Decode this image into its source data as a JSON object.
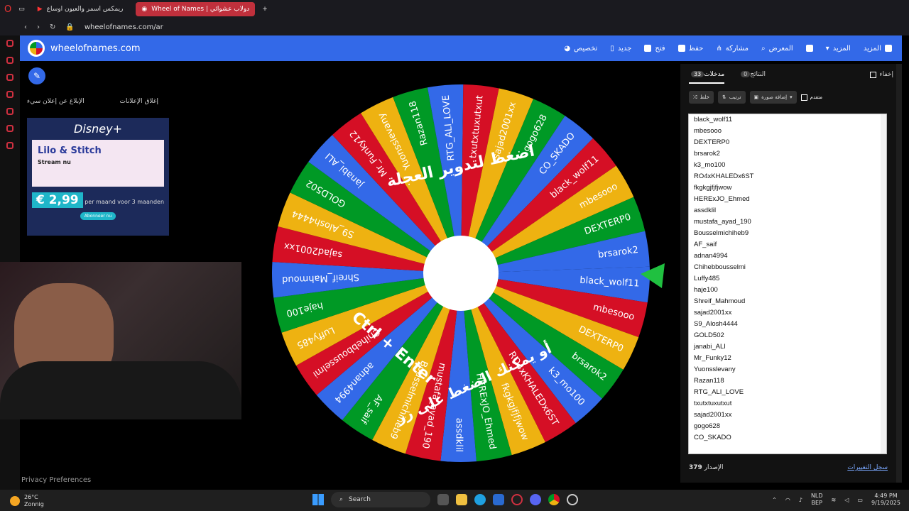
{
  "browser": {
    "tabs": [
      {
        "label": "ريمكس اسمر والعيون اوساع"
      },
      {
        "label": "Wheel of Names | دولاب عشوائي"
      }
    ],
    "url": "wheelofnames.com/ar"
  },
  "header": {
    "site_name": "wheelofnames.com",
    "menu": [
      "المزيد",
      "المزيد",
      "المعرض",
      "مشاركة",
      "حفظ",
      "فتح",
      "جديد",
      "تخصيص"
    ]
  },
  "ad": {
    "report_label": "الإبلاغ عن إعلان سيء",
    "close_label": "إغلاق الإعلانات",
    "brand": "Disney+",
    "movie": "Lilo & Stitch",
    "stream": "Stream nu",
    "price": "€ 2,99",
    "price_note": "per maand voor 3 maanden",
    "cta": "Abonneer nu"
  },
  "wheel": {
    "center_color": "#ffffff",
    "colors": [
      "#3369e8",
      "#d50f25",
      "#eeb211",
      "#009925"
    ],
    "overlay_text_1": "اضغط لتدوير العجلة",
    "overlay_text_2": "أو يمكنك الضغط على زر",
    "overlay_text_3": "Ctrl + Enter",
    "pointer_color": "#20c040"
  },
  "panel": {
    "tab_entries": "مدخلات",
    "entries_count": "33",
    "tab_results": "النتائج",
    "results_count": "0",
    "hide_label": "إخفاء",
    "shuffle_label": "خلط",
    "sort_label": "ترتيب",
    "add_image_label": "إضافة صورة",
    "advanced_label": "متقدم",
    "entries": [
      "black_wolf11",
      "mbesooo",
      "DEXTERP0",
      "brsarok2",
      "k3_mo100",
      "RO4xKHALEDx6ST",
      "fkgkgjfjfjwow",
      "HERExJO_Ehmed",
      "assdklil",
      "mustafa_ayad_190",
      "Bousselmichiheb9",
      "AF_saif",
      "adnan4994",
      "Chihebbousselmi",
      "Luffy485",
      "haje100",
      "Shreif_Mahmoud",
      "sajad2001xx",
      "S9_Alosh4444",
      "GOLD502",
      "janabi_ALI",
      "Mr_Funky12",
      "Yuonsslevany",
      "Razan118",
      "RTG_ALI_LOVE",
      "txutxtuxutxut",
      "sajad2001xx",
      "gogo628",
      "CO_SKADO"
    ],
    "version_label": "الإصدار",
    "version": "379",
    "changelog": "سجل التغييرات"
  },
  "page": {
    "privacy": "Privacy Preferences"
  },
  "taskbar": {
    "temp": "26°C",
    "weather": "Zonnig",
    "search": "Search",
    "lang_1": "NLD",
    "lang_2": "BEP",
    "time": "4:49 PM",
    "date": "9/19/2025"
  }
}
